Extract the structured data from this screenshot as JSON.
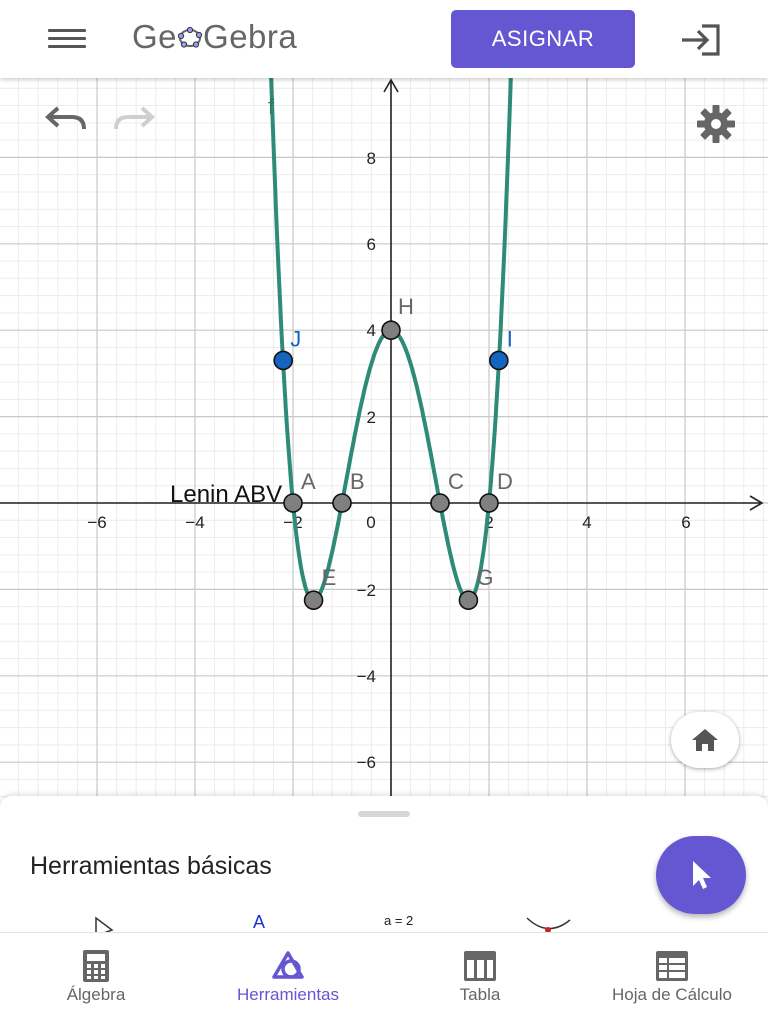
{
  "header": {
    "logo_text_left": "Ge",
    "logo_text_right": "Gebra",
    "assign_label": "ASIGNAR"
  },
  "graphics": {
    "annotation": "Lenin ABV",
    "function_label": "f",
    "x_ticks": [
      "−6",
      "−4",
      "−2",
      "0",
      "2",
      "4",
      "6"
    ],
    "y_ticks": [
      "8",
      "6",
      "4",
      "2",
      "−2",
      "−4",
      "−6"
    ],
    "points": [
      {
        "label": "A",
        "x": -2.0,
        "y": 0,
        "color": "#808080",
        "label_color": "#666666"
      },
      {
        "label": "B",
        "x": -1.0,
        "y": 0,
        "color": "#808080",
        "label_color": "#666666"
      },
      {
        "label": "C",
        "x": 1.0,
        "y": 0,
        "color": "#808080",
        "label_color": "#666666"
      },
      {
        "label": "D",
        "x": 2.0,
        "y": 0,
        "color": "#808080",
        "label_color": "#666666"
      },
      {
        "label": "E",
        "x": -1.58,
        "y": -2.25,
        "color": "#808080",
        "label_color": "#666666"
      },
      {
        "label": "G",
        "x": 1.58,
        "y": -2.25,
        "color": "#808080",
        "label_color": "#666666"
      },
      {
        "label": "H",
        "x": 0.0,
        "y": 4.0,
        "color": "#808080",
        "label_color": "#666666"
      },
      {
        "label": "J",
        "x": -2.2,
        "y": 3.3,
        "color": "#1565c0",
        "label_color": "#1565c0"
      },
      {
        "label": "I",
        "x": 2.2,
        "y": 3.3,
        "color": "#1565c0",
        "label_color": "#1565c0"
      }
    ],
    "curve_color": "#2e8b77"
  },
  "tools": {
    "title": "Herramientas básicas",
    "tool_a_label": "A",
    "tool_slider_label": "a = 2"
  },
  "nav": {
    "items": [
      {
        "label": "Álgebra"
      },
      {
        "label": "Herramientas"
      },
      {
        "label": "Tabla"
      },
      {
        "label": "Hoja de Cálculo"
      }
    ]
  },
  "colors": {
    "accent": "#6557d2"
  }
}
